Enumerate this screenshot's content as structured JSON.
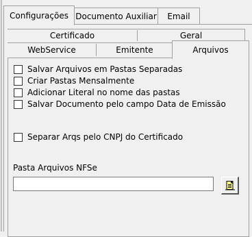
{
  "top_tabs": [
    "Configurações",
    "Documento Auxiliar",
    "Email"
  ],
  "sub_tabs_row1": [
    "Certificado",
    "Geral"
  ],
  "sub_tabs_row2": [
    "WebService",
    "Emitente",
    "Arquivos"
  ],
  "checkboxes": [
    {
      "label": "Salvar Arquivos em Pastas Separadas",
      "checked": false
    },
    {
      "label": "Criar Pastas Mensalmente",
      "checked": false
    },
    {
      "label": "Adicionar Literal no nome das pastas",
      "checked": false
    },
    {
      "label": "Salvar Documento pelo campo Data de Emissão",
      "checked": false
    },
    {
      "label": "Separar Arqs pelo CNPJ do Certificado",
      "checked": false
    }
  ],
  "pasta_nfse": {
    "label": "Pasta Arquivos NFSe",
    "value": "",
    "placeholder": ""
  },
  "icons": {
    "browse": "folder-browse-icon"
  }
}
